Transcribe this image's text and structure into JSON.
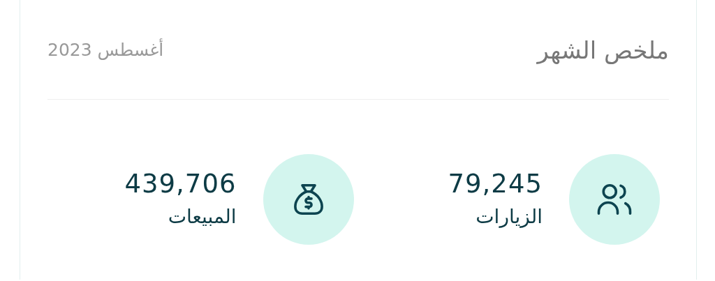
{
  "card": {
    "title": "ملخص الشهر",
    "period": "أغسطس 2023"
  },
  "stats": [
    {
      "kind": "visits",
      "value": "79,245",
      "label": "الزيارات"
    },
    {
      "kind": "sales",
      "value": "439,706",
      "label": "المبيعات"
    }
  ]
}
